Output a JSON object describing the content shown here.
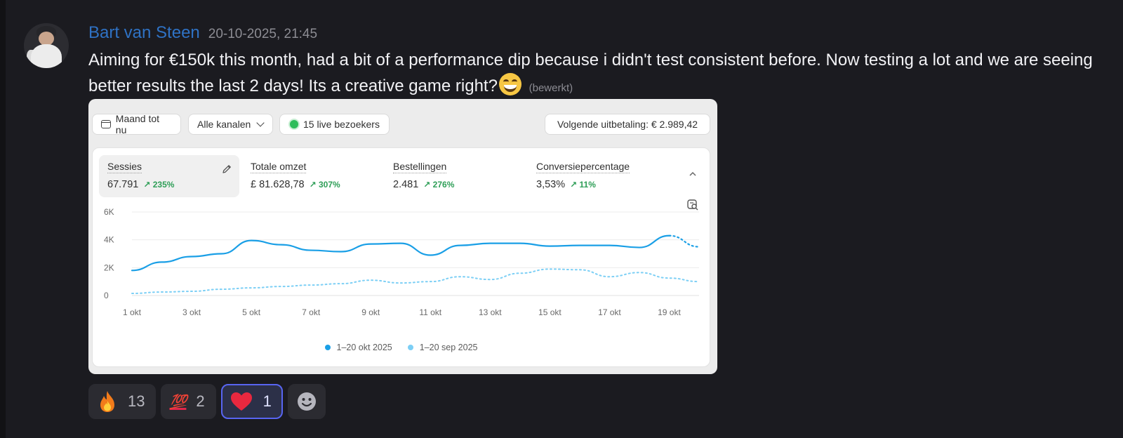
{
  "message": {
    "username": "Bart van Steen",
    "timestamp": "20-10-2025, 21:45",
    "text": "Aiming for €150k this month, had a bit of a performance dip because i didn't test consistent before. Now testing a lot and we are seeing better results the last 2 days! Its a creative game right?",
    "edited_label": "(bewerkt)",
    "colors": {
      "username": "#2f72c4",
      "background": "#1b1b20"
    }
  },
  "attachment": {
    "toolbar": {
      "date_range": "Maand tot nu",
      "channels": "Alle kanalen",
      "live_visitors": "15 live bezoekers",
      "payout": "Volgende uitbetaling: € 2.989,42"
    },
    "metrics": [
      {
        "label": "Sessies",
        "value": "67.791",
        "change": "↗ 235%"
      },
      {
        "label": "Totale omzet",
        "value": "£ 81.628,78",
        "change": "↗ 307%"
      },
      {
        "label": "Bestellingen",
        "value": "2.481",
        "change": "↗ 276%"
      },
      {
        "label": "Conversiepercentage",
        "value": "3,53%",
        "change": "↗ 11%"
      }
    ],
    "icons": [
      "calendar-icon",
      "chevron-down-icon",
      "live-dot-icon",
      "pencil-icon",
      "chevron-up-icon",
      "chart-insight-icon"
    ]
  },
  "chart_data": {
    "type": "line",
    "x": [
      "1 okt",
      "2 okt",
      "3 okt",
      "4 okt",
      "5 okt",
      "6 okt",
      "7 okt",
      "8 okt",
      "9 okt",
      "10 okt",
      "11 okt",
      "12 okt",
      "13 okt",
      "14 okt",
      "15 okt",
      "16 okt",
      "17 okt",
      "18 okt",
      "19 okt",
      "20 okt"
    ],
    "xticks": [
      "1 okt",
      "3 okt",
      "5 okt",
      "7 okt",
      "9 okt",
      "11 okt",
      "13 okt",
      "15 okt",
      "17 okt",
      "19 okt"
    ],
    "yticks": [
      "0",
      "2K",
      "4K",
      "6K"
    ],
    "ylim": [
      0,
      6000
    ],
    "grid": true,
    "legend_position": "bottom",
    "series": [
      {
        "name": "1–20 okt 2025",
        "color": "#1a9fe6",
        "style": "solid",
        "partial_dotted_from_index": 18,
        "values": [
          1800,
          2400,
          2800,
          3000,
          3950,
          3650,
          3250,
          3150,
          3700,
          3750,
          2900,
          3600,
          3750,
          3750,
          3550,
          3600,
          3600,
          3450,
          4300,
          3500
        ]
      },
      {
        "name": "1–20 sep 2025",
        "color": "#7ccff5",
        "style": "dotted",
        "values": [
          150,
          250,
          300,
          450,
          550,
          650,
          750,
          850,
          1100,
          900,
          1000,
          1350,
          1150,
          1600,
          1900,
          1850,
          1350,
          1650,
          1250,
          1000
        ]
      }
    ]
  },
  "reactions": [
    {
      "emoji": "fire-icon",
      "count": "13",
      "active": false
    },
    {
      "emoji": "hundred-points-icon",
      "emoji_text": "💯",
      "count": "2",
      "active": false
    },
    {
      "emoji": "heart-icon",
      "count": "1",
      "active": true,
      "accent": "#5865f2"
    },
    {
      "emoji": "add-reaction-smiley-icon",
      "count": "",
      "active": false
    }
  ]
}
